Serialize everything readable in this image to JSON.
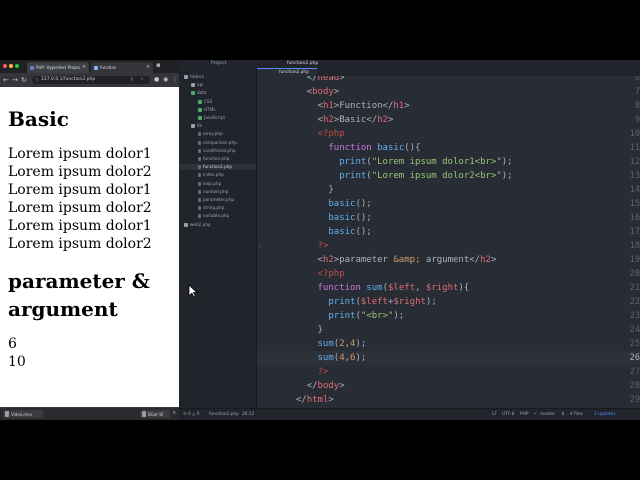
{
  "browser": {
    "tabs": [
      {
        "label": "PHP: Hypertext Prepro",
        "favicon_color": "#6c7eb7"
      },
      {
        "label": "function",
        "favicon_color": "#8ab4f8"
      }
    ],
    "url": "127.0.0.1/function2.php",
    "page": {
      "h1": "Basic",
      "lines": [
        "Lorem ipsum dolor1",
        "Lorem ipsum dolor2",
        "Lorem ipsum dolor1",
        "Lorem ipsum dolor2",
        "Lorem ipsum dolor1",
        "Lorem ipsum dolor2"
      ],
      "h2": "parameter & argument",
      "results": [
        "6",
        "10"
      ]
    },
    "downloads": [
      {
        "label": "Video.mov"
      },
      {
        "label": "BGet W"
      }
    ]
  },
  "editor": {
    "project_title": "Project",
    "file_title": "function2.php",
    "active_tab": "function2.php",
    "tree": [
      {
        "label": "htdocs",
        "type": "folder",
        "indent": 0
      },
      {
        "label": "api",
        "type": "folder",
        "indent": 1
      },
      {
        "label": "data",
        "type": "folder-open",
        "indent": 1
      },
      {
        "label": "CSS",
        "type": "folder-open",
        "indent": 2
      },
      {
        "label": "HTML",
        "type": "folder-open",
        "indent": 2
      },
      {
        "label": "JavaScript",
        "type": "folder-open",
        "indent": 2
      },
      {
        "label": "lib",
        "type": "folder",
        "indent": 1
      },
      {
        "label": "array.php",
        "type": "file",
        "indent": 2
      },
      {
        "label": "comparison.php",
        "type": "file",
        "indent": 2
      },
      {
        "label": "conditional.php",
        "type": "file",
        "indent": 2
      },
      {
        "label": "function.php",
        "type": "file",
        "indent": 2
      },
      {
        "label": "function2.php",
        "type": "file",
        "indent": 2,
        "selected": true
      },
      {
        "label": "index.php",
        "type": "file",
        "indent": 2
      },
      {
        "label": "loop.php",
        "type": "file",
        "indent": 2
      },
      {
        "label": "number.php",
        "type": "file",
        "indent": 2
      },
      {
        "label": "parameter.php",
        "type": "file",
        "indent": 2
      },
      {
        "label": "string.php",
        "type": "file",
        "indent": 2
      },
      {
        "label": "variable.php",
        "type": "file",
        "indent": 2
      },
      {
        "label": "web2.php",
        "type": "folder",
        "indent": 0
      }
    ],
    "current_line": "26",
    "code": [
      {
        "n": "6",
        "indent": 1,
        "tokens": [
          [
            "pun",
            "</"
          ],
          [
            "tag",
            "head"
          ],
          [
            "pun",
            ">"
          ]
        ]
      },
      {
        "n": "7",
        "indent": 1,
        "tokens": [
          [
            "pun",
            "<"
          ],
          [
            "tag",
            "body"
          ],
          [
            "pun",
            ">"
          ]
        ]
      },
      {
        "n": "8",
        "indent": 2,
        "tokens": [
          [
            "pun",
            "<"
          ],
          [
            "tag",
            "h1"
          ],
          [
            "pun",
            ">Function</"
          ],
          [
            "tag",
            "h1"
          ],
          [
            "pun",
            ">"
          ]
        ]
      },
      {
        "n": "9",
        "indent": 2,
        "tokens": [
          [
            "pun",
            "<"
          ],
          [
            "tag",
            "h2"
          ],
          [
            "pun",
            ">Basic</"
          ],
          [
            "tag",
            "h2"
          ],
          [
            "pun",
            ">"
          ]
        ]
      },
      {
        "n": "10",
        "indent": 2,
        "tokens": [
          [
            "php",
            "<?php"
          ]
        ]
      },
      {
        "n": "11",
        "indent": 3,
        "tokens": [
          [
            "kw",
            "function "
          ],
          [
            "fn",
            "basic"
          ],
          [
            "pun",
            "(){"
          ]
        ]
      },
      {
        "n": "12",
        "indent": 4,
        "tokens": [
          [
            "fn",
            "print"
          ],
          [
            "pun",
            "("
          ],
          [
            "str",
            "\"Lorem ipsum dolor1<br>\""
          ],
          [
            "pun",
            ");"
          ]
        ]
      },
      {
        "n": "13",
        "indent": 4,
        "tokens": [
          [
            "fn",
            "print"
          ],
          [
            "pun",
            "("
          ],
          [
            "str",
            "\"Lorem ipsum dolor2<br>\""
          ],
          [
            "pun",
            ");"
          ]
        ]
      },
      {
        "n": "14",
        "indent": 3,
        "tokens": [
          [
            "pun",
            "}"
          ]
        ]
      },
      {
        "n": "15",
        "indent": 3,
        "tokens": [
          [
            "fn",
            "basic"
          ],
          [
            "pun",
            "();"
          ]
        ]
      },
      {
        "n": "16",
        "indent": 3,
        "tokens": [
          [
            "fn",
            "basic"
          ],
          [
            "pun",
            "();"
          ]
        ]
      },
      {
        "n": "17",
        "indent": 3,
        "tokens": [
          [
            "fn",
            "basic"
          ],
          [
            "pun",
            "();"
          ]
        ]
      },
      {
        "n": "18",
        "indent": 2,
        "tokens": [
          [
            "php",
            "?>"
          ]
        ]
      },
      {
        "n": "19",
        "indent": 2,
        "tokens": [
          [
            "pun",
            "<"
          ],
          [
            "tag",
            "h2"
          ],
          [
            "pun",
            ">parameter "
          ],
          [
            "num",
            "&amp;"
          ],
          [
            "pun",
            " argument</"
          ],
          [
            "tag",
            "h2"
          ],
          [
            "pun",
            ">"
          ]
        ]
      },
      {
        "n": "20",
        "indent": 2,
        "tokens": [
          [
            "php",
            "<?php"
          ]
        ]
      },
      {
        "n": "21",
        "indent": 2,
        "tokens": [
          [
            "kw",
            "function "
          ],
          [
            "fn",
            "sum"
          ],
          [
            "pun",
            "("
          ],
          [
            "var",
            "$left"
          ],
          [
            "pun",
            ", "
          ],
          [
            "var",
            "$right"
          ],
          [
            "pun",
            "){"
          ]
        ]
      },
      {
        "n": "22",
        "indent": 3,
        "tokens": [
          [
            "fn",
            "print"
          ],
          [
            "pun",
            "("
          ],
          [
            "var",
            "$left"
          ],
          [
            "pun",
            "+"
          ],
          [
            "var",
            "$right"
          ],
          [
            "pun",
            ");"
          ]
        ]
      },
      {
        "n": "23",
        "indent": 3,
        "tokens": [
          [
            "fn",
            "print"
          ],
          [
            "pun",
            "("
          ],
          [
            "str",
            "\"<br>\""
          ],
          [
            "pun",
            ");"
          ]
        ]
      },
      {
        "n": "24",
        "indent": 2,
        "tokens": [
          [
            "pun",
            "}"
          ]
        ]
      },
      {
        "n": "25",
        "indent": 2,
        "tokens": [
          [
            "fn",
            "sum"
          ],
          [
            "pun",
            "("
          ],
          [
            "num",
            "2"
          ],
          [
            "pun",
            ","
          ],
          [
            "num",
            "4"
          ],
          [
            "pun",
            ");"
          ]
        ]
      },
      {
        "n": "26",
        "indent": 2,
        "tokens": [
          [
            "fn",
            "sum"
          ],
          [
            "pun",
            "("
          ],
          [
            "num",
            "4"
          ],
          [
            "pun",
            ","
          ],
          [
            "num",
            "6"
          ],
          [
            "pun",
            ");"
          ]
        ]
      },
      {
        "n": "27",
        "indent": 2,
        "tokens": [
          [
            "php",
            "?>"
          ]
        ]
      },
      {
        "n": "28",
        "indent": 1,
        "tokens": [
          [
            "pun",
            "</"
          ],
          [
            "tag",
            "body"
          ],
          [
            "pun",
            ">"
          ]
        ]
      },
      {
        "n": "29",
        "indent": 0,
        "tokens": [
          [
            "pun",
            "</"
          ],
          [
            "tag",
            "html"
          ],
          [
            "pun",
            ">"
          ]
        ]
      }
    ],
    "status": {
      "file": "function2.php",
      "position": "26:12",
      "line_ending": "LF",
      "encoding": "UTF-8",
      "grammar": "PHP",
      "branch": "master",
      "files": "4 files",
      "updates": "2 updates"
    }
  },
  "colors": {
    "accent": "#528bff",
    "folder_open": "#4fa96b",
    "updates": "#528bff"
  }
}
